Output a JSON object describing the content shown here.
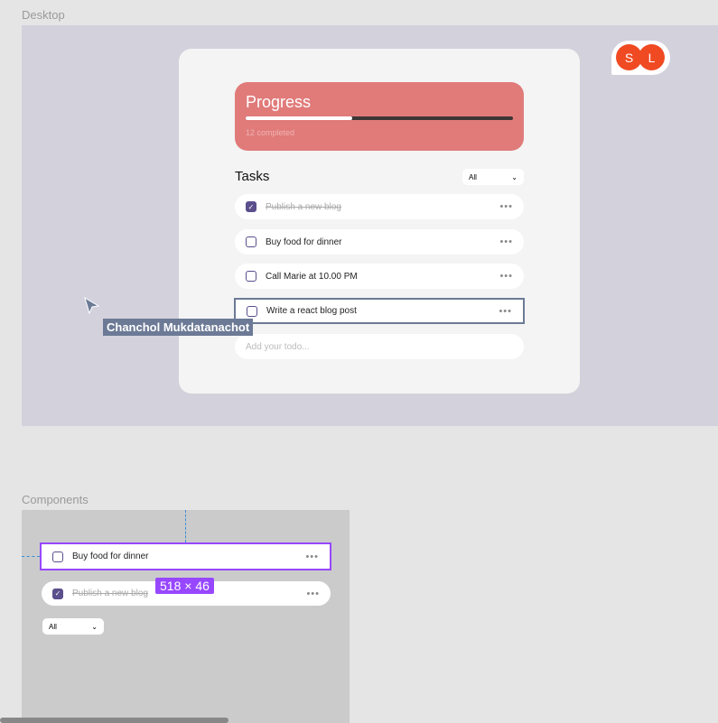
{
  "frames": {
    "desktop": "Desktop",
    "components": "Components"
  },
  "progress": {
    "title": "Progress",
    "fraction": 0.4,
    "completed": "12 completed"
  },
  "tasks": {
    "title": "Tasks",
    "filter": "All",
    "chevron": "⌄",
    "more": "•••",
    "items": [
      {
        "label": "Publish a new blog",
        "done": true
      },
      {
        "label": "Buy food for dinner",
        "done": false
      },
      {
        "label": "Call Marie at 10.00 PM",
        "done": false
      },
      {
        "label": "Write a react blog post",
        "done": false
      }
    ],
    "placeholder": "Add your todo..."
  },
  "collaborators": [
    "S",
    "L"
  ],
  "cursor_user": "Chanchol Mukdatanachot",
  "components": {
    "row1": "Buy food for dinner",
    "row2": "Publish a new blog",
    "size": "518 × 46",
    "filter": "All"
  },
  "colors": {
    "progress": "#e07b7a",
    "check": "#5b4f8c",
    "selection": "#9747ff",
    "avatar": "#f04a23"
  }
}
